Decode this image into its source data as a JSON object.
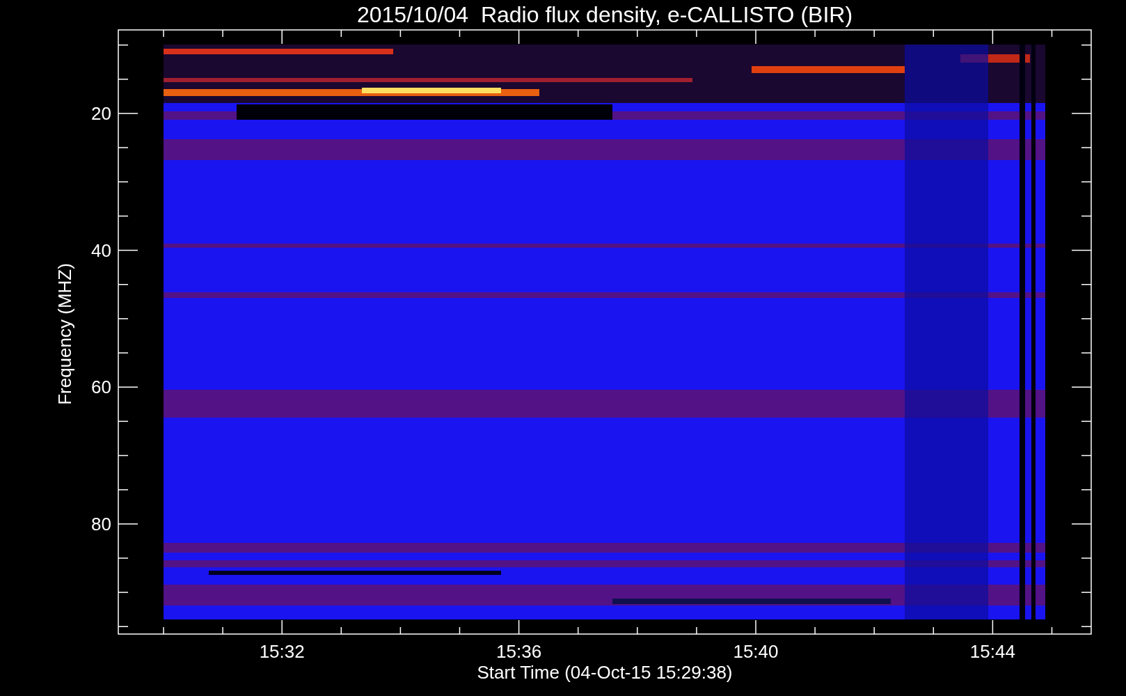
{
  "title": "2015/10/04  Radio flux density, e-CALLISTO (BIR)",
  "x_axis": {
    "label": "Start Time (04-Oct-15 15:29:38)",
    "ticks": [
      "15:32",
      "15:36",
      "15:40",
      "15:44"
    ]
  },
  "y_axis": {
    "label": "Frequency (MHZ)",
    "ticks": [
      "20",
      "40",
      "60",
      "80"
    ]
  }
}
